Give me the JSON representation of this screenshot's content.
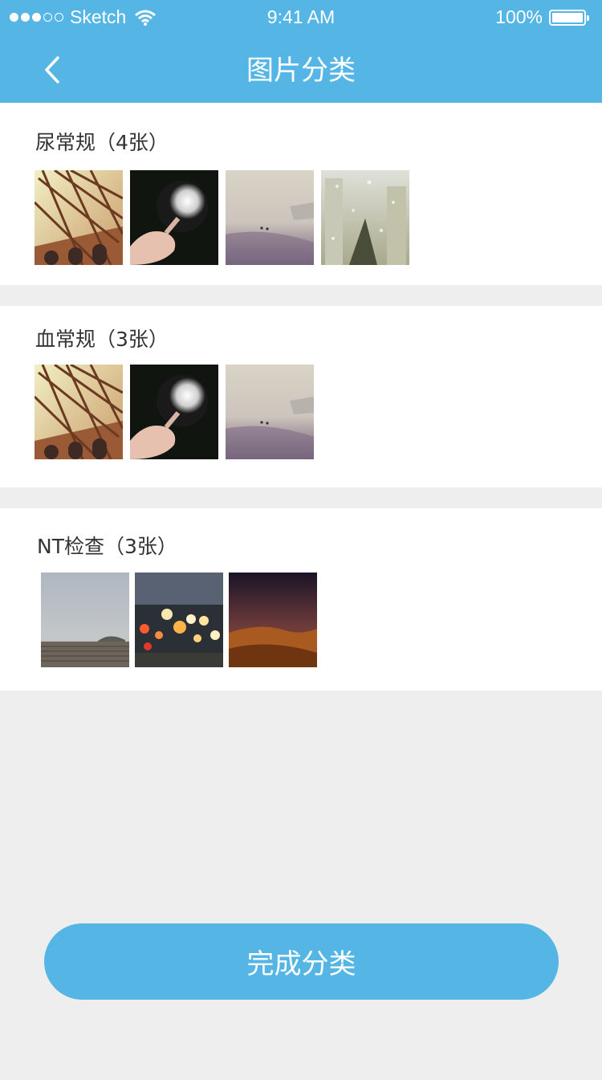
{
  "status_bar": {
    "carrier": "Sketch",
    "time": "9:41 AM",
    "battery": "100%"
  },
  "header": {
    "title": "图片分类",
    "back_icon": "chevron-left-icon"
  },
  "sections": [
    {
      "title": "尿常规（4张）",
      "images": [
        "building-photo",
        "dandelion-photo",
        "beach-photo",
        "rainy-window-photo"
      ]
    },
    {
      "title": "血常规（3张）",
      "images": [
        "building-photo",
        "dandelion-photo",
        "beach-photo"
      ]
    },
    {
      "title": "NT检查（3张）",
      "images": [
        "foggy-pier-photo",
        "bokeh-lights-photo",
        "desert-dusk-photo"
      ]
    }
  ],
  "footer": {
    "done_label": "完成分类"
  },
  "colors": {
    "accent": "#55b6e6",
    "background": "#eeeeee",
    "text": "#333333"
  }
}
